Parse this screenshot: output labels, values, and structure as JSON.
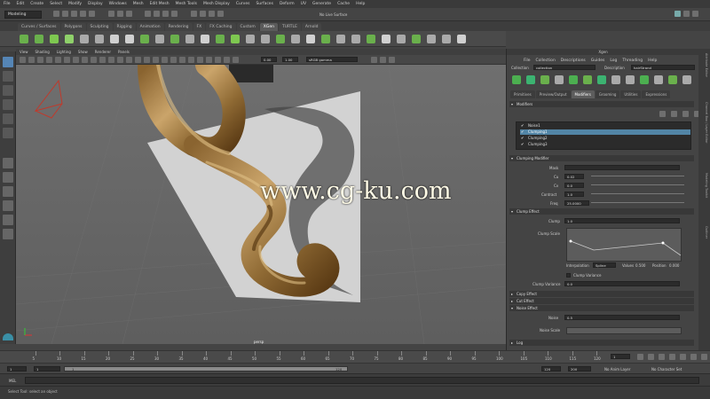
{
  "menubar": [
    "File",
    "Edit",
    "Create",
    "Select",
    "Modify",
    "Display",
    "Windows",
    "Mesh",
    "Edit Mesh",
    "Mesh Tools",
    "Mesh Display",
    "Curves",
    "Surfaces",
    "Deform",
    "UV",
    "Generate",
    "Cache",
    "Help"
  ],
  "status": {
    "mode": "Modeling",
    "live_surface": "No Live Surface"
  },
  "shelf_tabs": [
    "Curves / Surfaces",
    "Polygons",
    "Sculpting",
    "Rigging",
    "Animation",
    "Rendering",
    "FX",
    "FX Caching",
    "Custom",
    "XGen",
    "TURTLE",
    "Arnold"
  ],
  "shelf_active": "XGen",
  "viewport": {
    "menu": [
      "View",
      "Shading",
      "Lighting",
      "Show",
      "Renderer",
      "Panels"
    ],
    "field_a": "0.00",
    "field_b": "1.00",
    "color_space": "sRGB gamma",
    "camera_label": "persp",
    "watermark": "www.cg-ku.com"
  },
  "editor": {
    "title": "Xgen",
    "menu": [
      "File",
      "Collection",
      "Descriptions",
      "Guides",
      "Log",
      "Threading",
      "Help"
    ],
    "collection_label": "Collection",
    "collection_value": "collection",
    "description_label": "Description",
    "description_value": "hairStrand",
    "tabs": [
      "Primitives",
      "Preview/Output",
      "Modifiers",
      "Grooming",
      "Utilities",
      "Expressions"
    ],
    "active_tab": "Modifiers",
    "modifiers_header": "Modifiers",
    "modifier_list": [
      "Noise1",
      "Clumping1",
      "Clumping2",
      "Clumping3"
    ],
    "selected_modifier": "Clumping1",
    "clumping_header": "Clumping Modifier",
    "mask_label": "Mask",
    "cu_label": "Cu",
    "cu_value": "0.02",
    "cv_label": "Cv",
    "cv_value": "0.0",
    "contract_label": "Contract",
    "contract_value": "1.0",
    "freq_label": "Freq",
    "freq_value": "25.0000",
    "clump_effect_header": "Clump Effect",
    "clump_label": "Clump",
    "clump_value": "1.0",
    "clump_scale_label": "Clump Scale",
    "interp_label": "Interpolation",
    "interp_value": "Spline",
    "values_label": "Values",
    "values_value": "0.500",
    "position_label": "Position",
    "position_value": "0.000",
    "clump_variance_chk": "Clump Variance",
    "clump_variance_label": "Clump Variance",
    "clump_variance_value": "0.0",
    "copy_effect": "Copy Effect",
    "cut_effect": "Cut Effect",
    "noise_effect": "Noise Effect",
    "noise_label": "Noise",
    "noise_value": "0.5",
    "noise_scale_label": "Noise Scale",
    "log_label": "Log"
  },
  "right_strip": [
    "Attribute Editor",
    "Channel Box / Layer Editor",
    "Modeling Toolkit",
    "Outliner"
  ],
  "timeline": {
    "ticks": [
      "5",
      "10",
      "15",
      "20",
      "25",
      "30",
      "35",
      "40",
      "45",
      "50",
      "55",
      "60",
      "65",
      "70",
      "75",
      "80",
      "85",
      "90",
      "95",
      "100",
      "105",
      "110",
      "115",
      "120"
    ],
    "current_frame": "1"
  },
  "range": {
    "start": "1",
    "start2": "1",
    "slider_start": "1",
    "slider_end": "120",
    "end": "120",
    "end2": "200",
    "anim_layer": "No Anim Layer",
    "char_set": "No Character Set"
  },
  "mel_label": "MEL",
  "help": "Select Tool: select an object",
  "colors": {
    "accent": "#5285a6",
    "hair_dark": "#5a3a14",
    "hair_light": "#caa46a",
    "plane": "#d2d2d2"
  }
}
